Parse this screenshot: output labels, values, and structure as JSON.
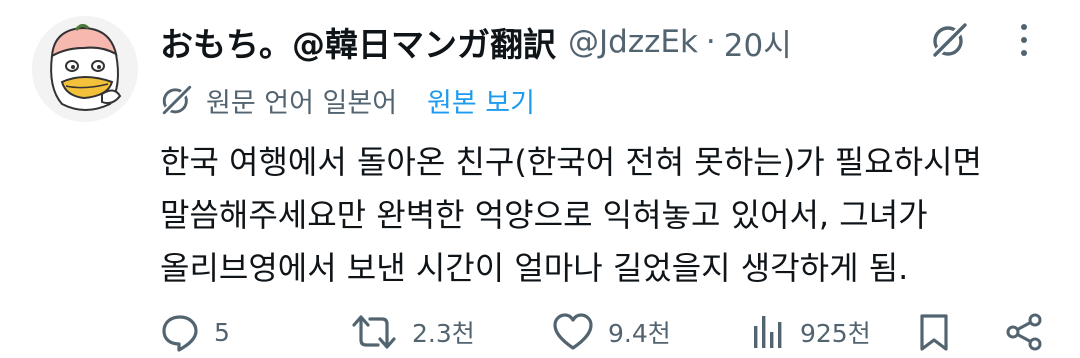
{
  "post": {
    "author_name": "おもち。@韓日マンガ翻訳",
    "handle": "@JdzzEk",
    "separator": "·",
    "time": "20시",
    "translation_label": "원문 언어 일본어",
    "show_original": "원본 보기",
    "text_lines": [
      "한국 여행에서 돌아온 친구(한국어 전혀 못하는)가 필요하시면",
      "말씀해주세요만 완벽한 억양으로 익혀놓고 있어서, 그녀가",
      "올리브영에서 보낸 시간이 얼마나 길었을지 생각하게 됨."
    ]
  },
  "actions": {
    "replies": "5",
    "reposts": "2.3천",
    "likes": "9.4천",
    "views": "925천"
  },
  "icons": {
    "avatar": "duck-avatar",
    "grok": "grok-icon",
    "more": "more-icon",
    "reply": "reply-icon",
    "repost": "repost-icon",
    "like": "heart-icon",
    "views": "views-icon",
    "bookmark": "bookmark-icon",
    "share": "share-icon"
  },
  "colors": {
    "text": "#0f1419",
    "secondary": "#536471",
    "link": "#1d9bf0"
  }
}
